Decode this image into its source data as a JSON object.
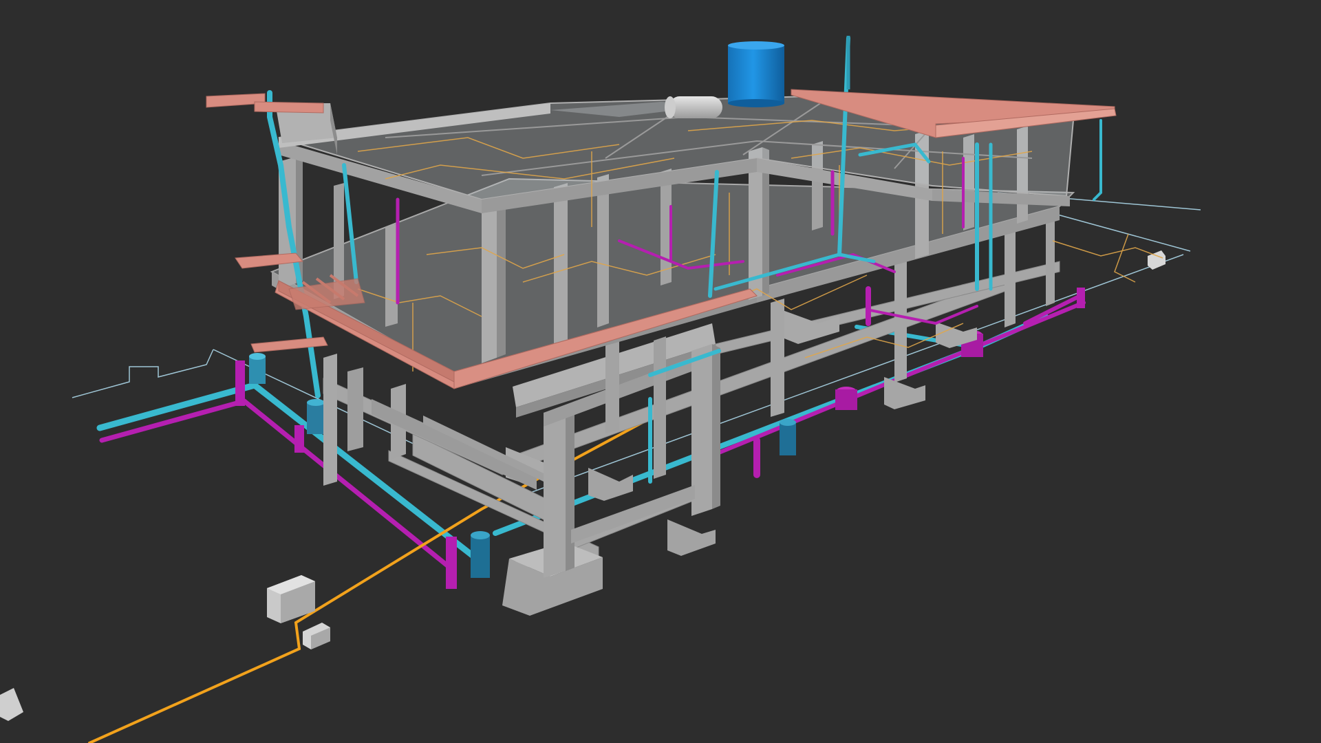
{
  "viewer": {
    "background": "#2d2d2d"
  },
  "palette": {
    "concrete": "#a9a9a9",
    "concrete_dark": "#8c8c8c",
    "concrete_light": "#c4c4c4",
    "slab_glass": "#b8bcbf",
    "beam_salmon": "#d88c80",
    "pipe_cyan": "#39b9cf",
    "pipe_magenta": "#b51fb0",
    "cable_orange": "#f0a020",
    "wire_thin": "#e0a64a",
    "water_tank": "#1a86d1",
    "tank_dark": "#14507e",
    "box_white": "#d9d9d9"
  },
  "model": {
    "components": [
      "concrete-frame",
      "roof-slab",
      "first-floor-slab",
      "water-tank",
      "solar-heater",
      "salmon-roof-beams",
      "cyan-water-pipes",
      "magenta-drain-pipes",
      "orange-electric-cables",
      "inspection-boxes",
      "ground-wire"
    ]
  }
}
